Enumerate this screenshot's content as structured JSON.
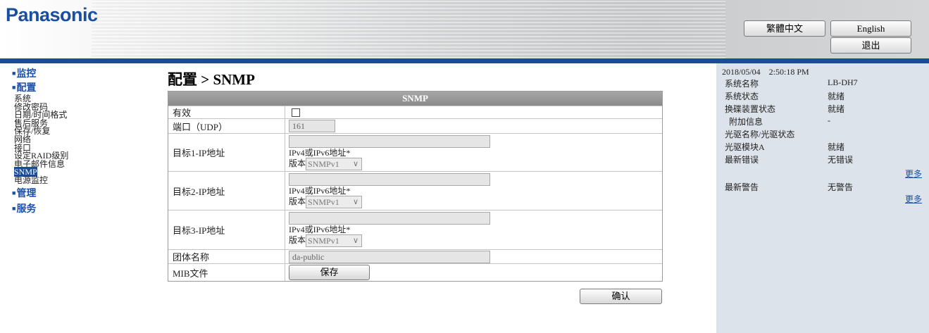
{
  "header": {
    "logo": "Panasonic",
    "lang_tc": "繁體中文",
    "lang_en": "English",
    "logout": "退出"
  },
  "nav": {
    "monitor": "监控",
    "config": "配置",
    "config_items": [
      "系统",
      "修改密码",
      "日期/时间格式",
      "售后服务",
      "保存/恢复",
      "网络",
      "接口",
      "设定RAID级别",
      "电子邮件信息",
      "SNMP",
      "电源监控"
    ],
    "manage": "管理",
    "service": "服务"
  },
  "page_title": "配置 > SNMP",
  "snmp": {
    "header": "SNMP",
    "enabled_label": "有效",
    "enabled": false,
    "port_label": "端口（UDP）",
    "port_value": "161",
    "targets": [
      {
        "label": "目标1-IP地址",
        "ip_value": "",
        "hint": "IPv4或IPv6地址*",
        "version_label": "版本",
        "version": "SNMPv1"
      },
      {
        "label": "目标2-IP地址",
        "ip_value": "",
        "hint": "IPv4或IPv6地址*",
        "version_label": "版本",
        "version": "SNMPv1"
      },
      {
        "label": "目标3-IP地址",
        "ip_value": "",
        "hint": "IPv4或IPv6地址*",
        "version_label": "版本",
        "version": "SNMPv1"
      }
    ],
    "community_label": "团体名称",
    "community_value": "da-public",
    "mib_label": "MIB文件",
    "save_label": "保存"
  },
  "confirm_label": "确认",
  "status": {
    "date": "2018/05/04",
    "time": "2:50:18 PM",
    "rows": [
      {
        "k": "系统名称",
        "v": "LB-DH7"
      },
      {
        "k": "系统状态",
        "v": "就绪"
      },
      {
        "k": "换碟装置状态",
        "v": "就绪"
      },
      {
        "k": " 附加信息",
        "v": "-"
      },
      {
        "k": "光驱名称/光驱状态",
        "v": ""
      },
      {
        "k": "光驱模块A",
        "v": "就绪"
      },
      {
        "k": "最新错误",
        "v": "无错误"
      },
      {
        "k": "最新警告",
        "v": "无警告"
      }
    ],
    "more1": "更多",
    "more2": "更多"
  },
  "colors": {
    "brand_blue": "#1b4c99",
    "nav_blue": "#1c4fa6",
    "table_header": "#8f8f8f",
    "right_panel": "#dde3ea"
  }
}
